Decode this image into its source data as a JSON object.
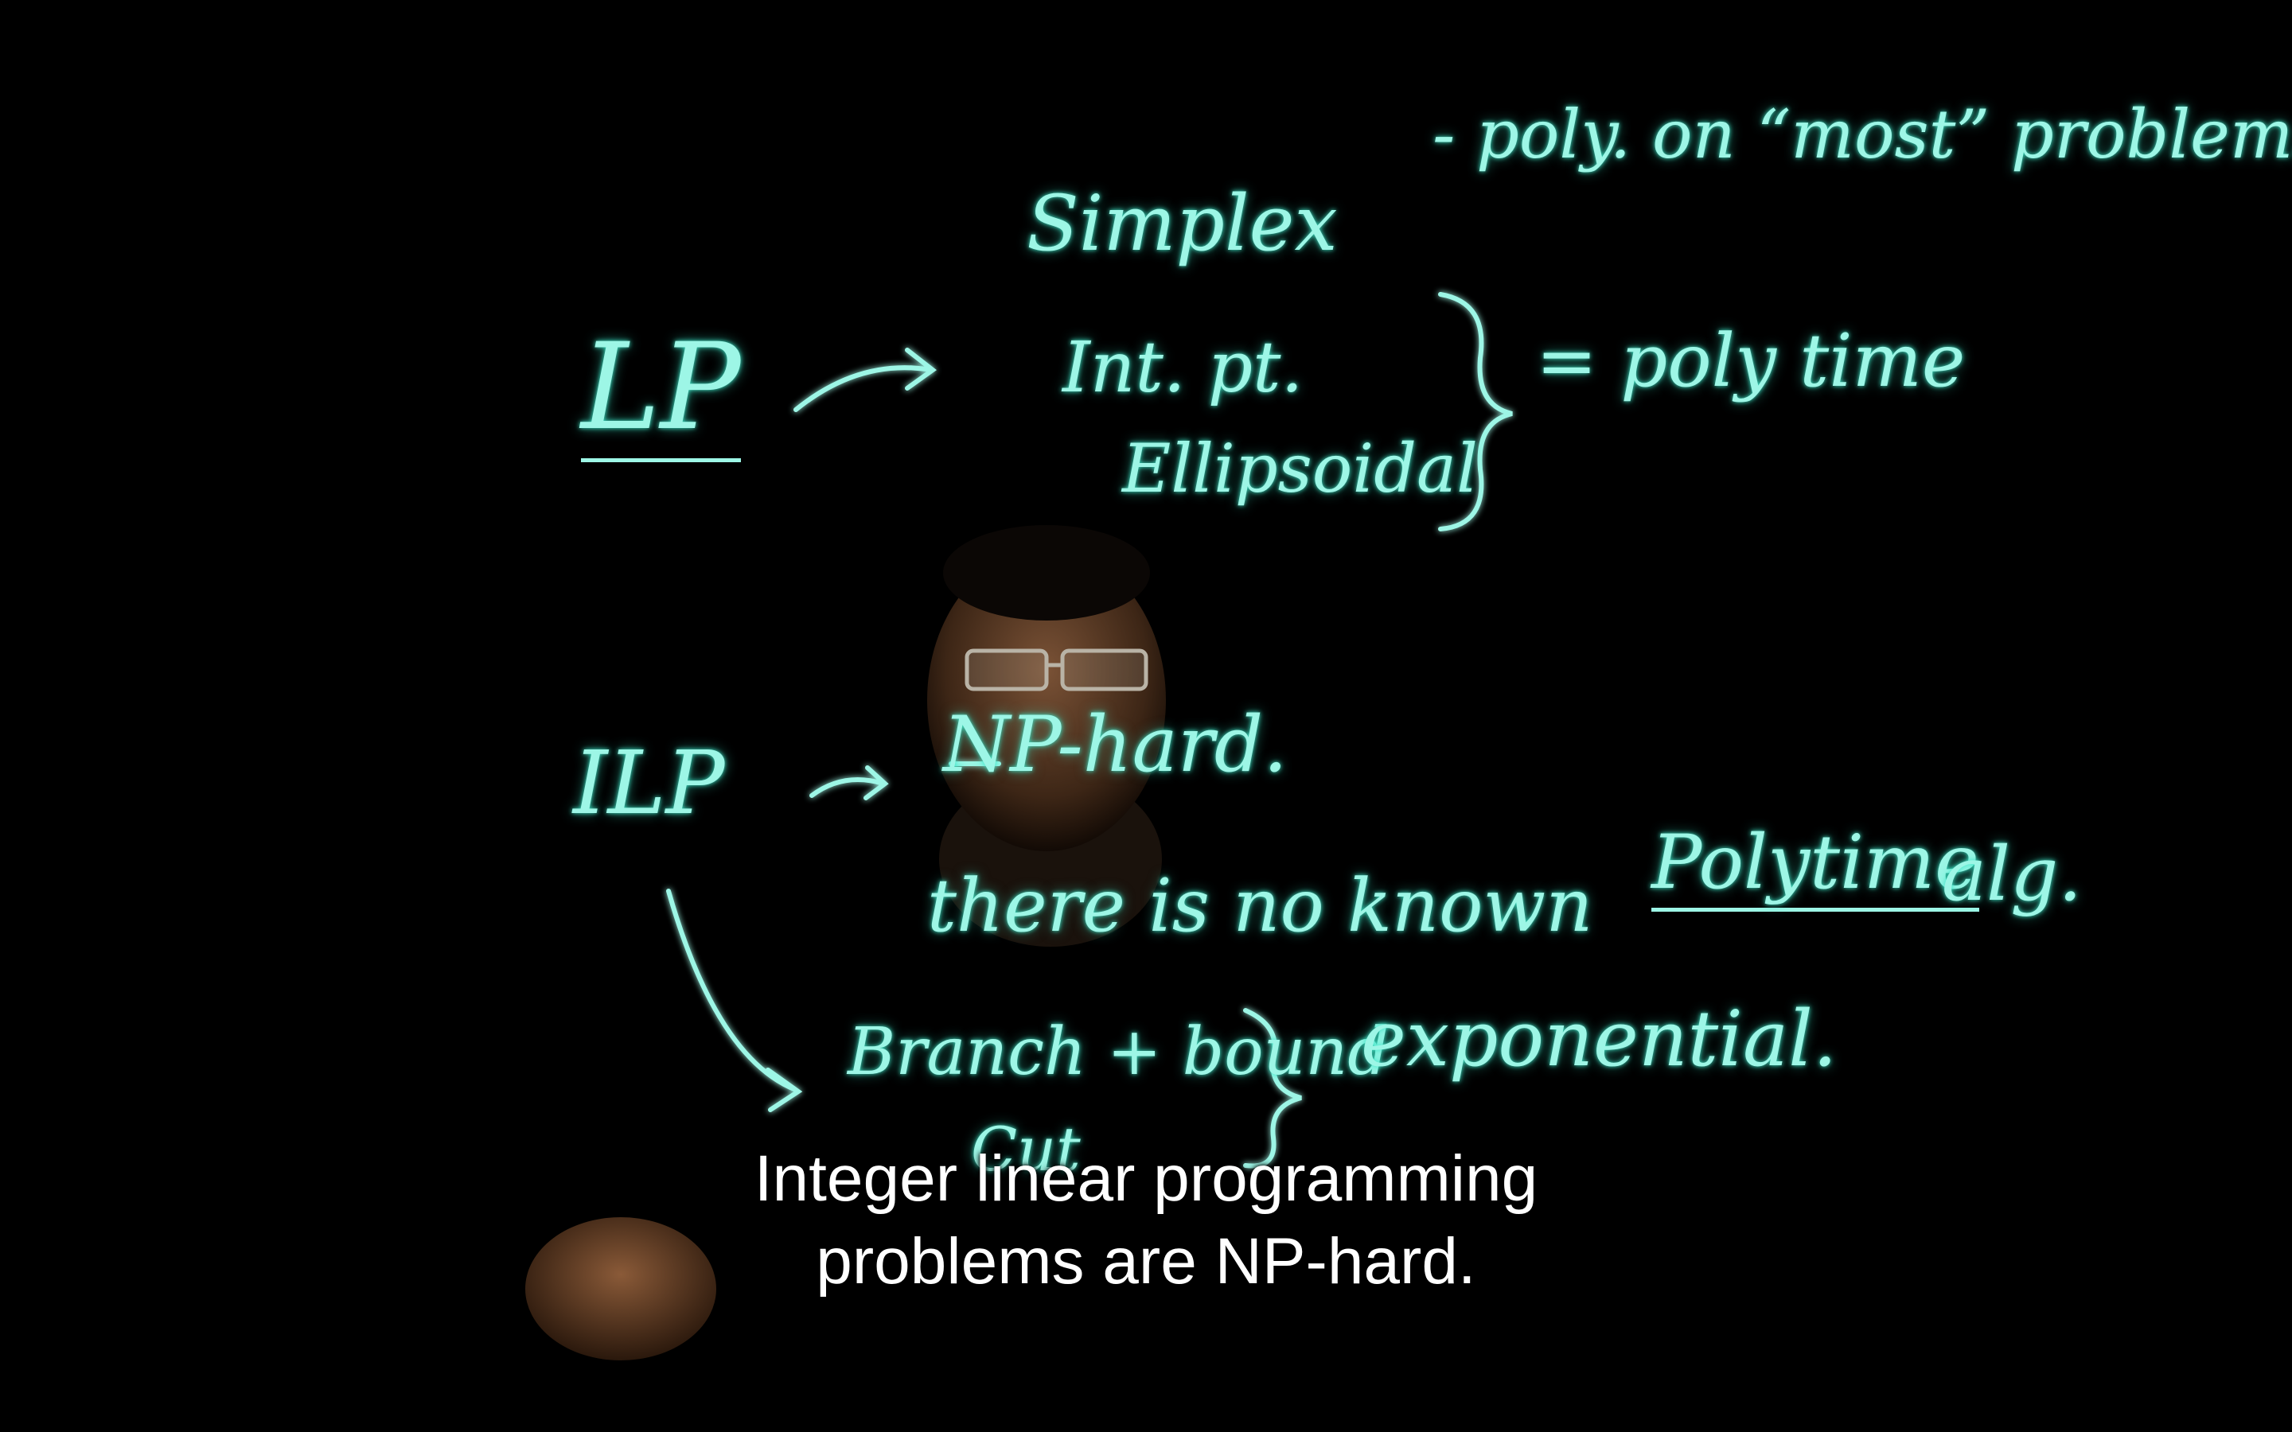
{
  "board": {
    "lp": {
      "label": "LP",
      "simplex": "Simplex",
      "simplex_note": "- poly. on “most” problems",
      "int_pt": "Int. pt.",
      "ellipsoidal": "Ellipsoidal",
      "poly_time": "= poly time"
    },
    "ilp": {
      "label": "ILP",
      "np_hard": "NP-hard.",
      "no_known": "there is no known",
      "polytime": "Polytime",
      "alg": "alg.",
      "branch_bound": "Branch + bound",
      "exponential": "exponential.",
      "cut": "Cut"
    }
  },
  "subtitles": {
    "line1": "Integer linear programming",
    "line2": "problems are NP-hard."
  },
  "colors": {
    "ink": "#9df6e6",
    "glow": "#3fe6c8",
    "background": "#000000",
    "subtitle": "#ffffff"
  }
}
